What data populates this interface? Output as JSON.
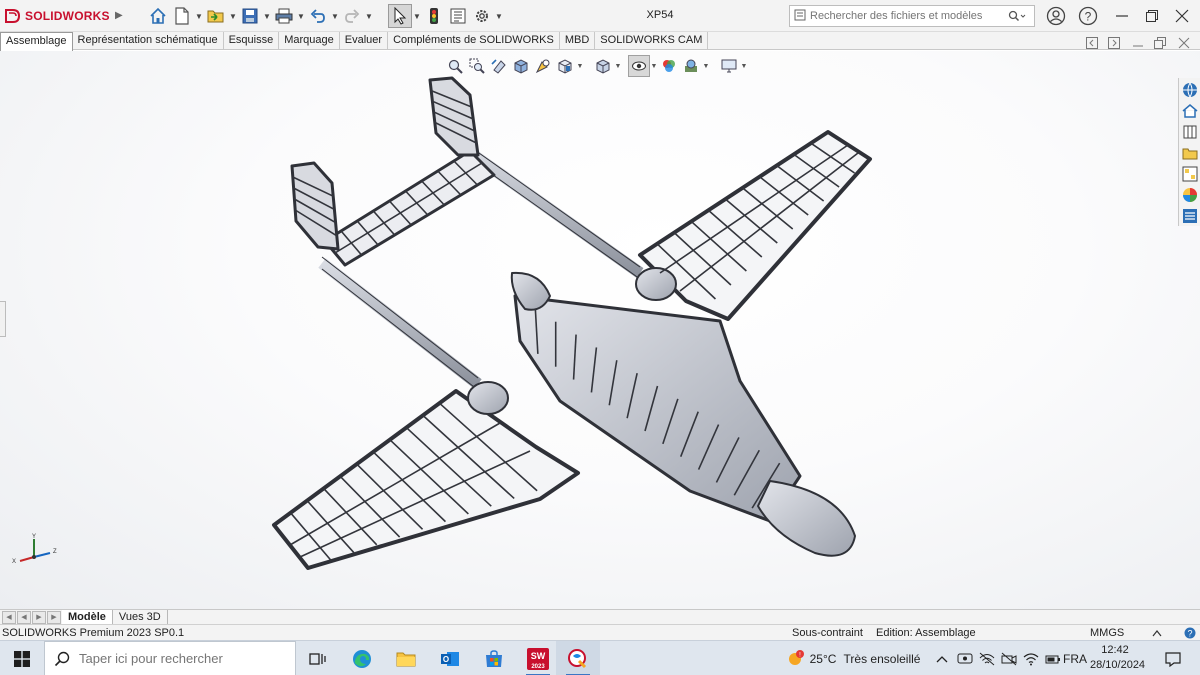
{
  "app": {
    "brand": "SOLIDWORKS",
    "document_title": "XP54"
  },
  "search": {
    "placeholder": "Rechercher des fichiers et modèles"
  },
  "tabs": [
    {
      "label": "Assemblage",
      "active": true
    },
    {
      "label": "Représentation schématique",
      "active": false
    },
    {
      "label": "Esquisse",
      "active": false
    },
    {
      "label": "Marquage",
      "active": false
    },
    {
      "label": "Evaluer",
      "active": false
    },
    {
      "label": "Compléments de SOLIDWORKS",
      "active": false
    },
    {
      "label": "MBD",
      "active": false
    },
    {
      "label": "SOLIDWORKS CAM",
      "active": false
    }
  ],
  "triad": {
    "x": "X",
    "y": "Y",
    "z": "Z"
  },
  "model_tabs": [
    {
      "label": "Modèle",
      "active": true
    },
    {
      "label": "Vues 3D",
      "active": false
    }
  ],
  "statusbar": {
    "product": "SOLIDWORKS Premium 2023 SP0.1",
    "constraint": "Sous-contraint",
    "mode": "Edition: Assemblage",
    "units": "MMGS"
  },
  "taskbar": {
    "search_placeholder": "Taper ici pour rechercher",
    "sw_badge": "2023",
    "weather_temp": "25°C",
    "weather_desc": "Très ensoleillé",
    "language": "FRA",
    "time": "12:42",
    "date": "28/10/2024"
  },
  "colors": {
    "brand_red": "#c8102e",
    "accent_blue": "#3a76c4",
    "viewport_bg": "#f4f5f7"
  }
}
